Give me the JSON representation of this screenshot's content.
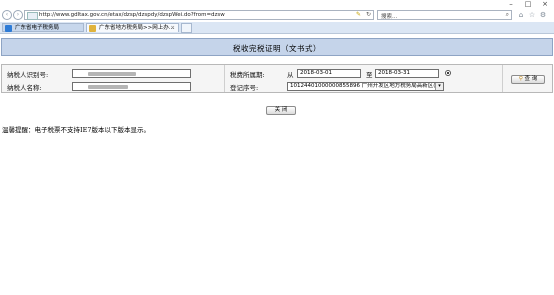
{
  "browser": {
    "url": "http://www.gdltax.gov.cn/etax/dzsp/dzspdy/dzspWei.do?from=dzsw",
    "search_placeholder": "搜索...",
    "tabs": [
      {
        "label": "广东省电子税务局"
      },
      {
        "label": "广东省地方税务局>>网上办..."
      }
    ],
    "window_controls": [
      "–",
      "□",
      "×"
    ]
  },
  "page": {
    "title": "税收完税证明（文书式）"
  },
  "form": {
    "taxpayer_id_label": "纳税人识别号:",
    "taxpayer_name_label": "纳税人名称:",
    "tax_period_label": "税费所属期:",
    "from_label": "从",
    "date_from": "2018-03-01",
    "to_label": "至",
    "date_to": "2018-03-31",
    "registration_no_label": "登记序号:",
    "registration_selected": "10124401000000855896  广州开发区地方税务局高新区(",
    "query_button": "查  询"
  },
  "actions": {
    "close_button": "关  闭"
  },
  "notice": {
    "text": "温馨提醒：电子税票不支持IE7版本以下版本显示。"
  }
}
